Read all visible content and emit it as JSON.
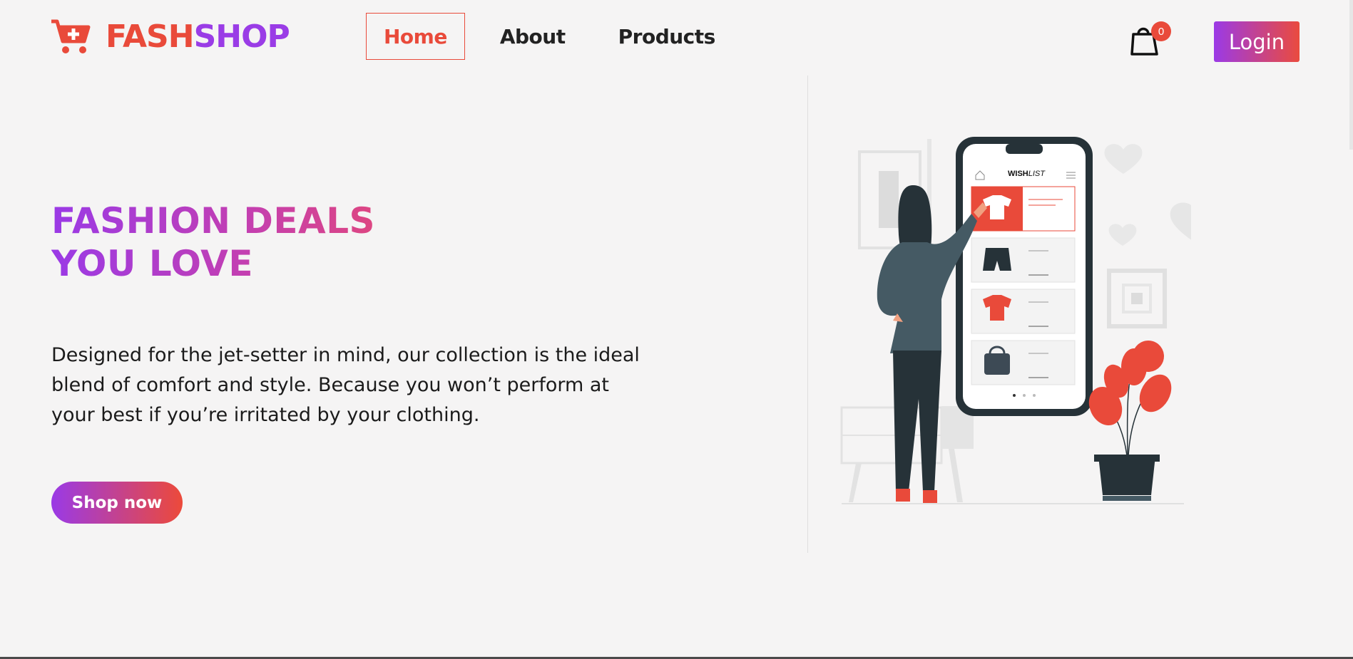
{
  "header": {
    "logo": {
      "part1": "FASH",
      "part2": "SHOP",
      "icon": "shopping-cart-plus-icon"
    },
    "nav": [
      {
        "label": "Home",
        "active": true
      },
      {
        "label": "About",
        "active": false
      },
      {
        "label": "Products",
        "active": false
      }
    ],
    "cart": {
      "icon": "shopping-bag-icon",
      "count": "0"
    },
    "login_label": "Login"
  },
  "hero": {
    "title_line1": "FASHION DEALS",
    "title_line2": "YOU LOVE",
    "description": "Designed for the jet-setter in mind, our collection is the ideal blend of comfort and style. Because you won’t perform at your best if you’re irritated by your clothing.",
    "cta_label": "Shop now"
  },
  "illustration": {
    "phone_title_a": "WISH",
    "phone_title_b": "LIST"
  },
  "colors": {
    "accent_red": "#e94a3a",
    "accent_purple": "#9a3ce6",
    "background": "#f5f4f4"
  }
}
